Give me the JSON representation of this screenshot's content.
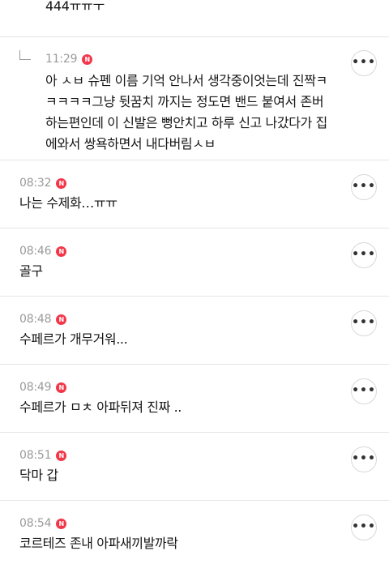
{
  "top_partial": {
    "text": "444ㅠㅠㅜ"
  },
  "reply": {
    "time": "11:29",
    "badge": "N",
    "text": "아 ㅅㅂ 슈펜 이름 기억 안나서 생각중이엇는데 진짝ㅋ\nㅋㅋㅋㅋ그냥 뒷꿈치 까지는 정도면 밴드 붙여서 존버\n하는편인데 이 신발은 뻥안치고 하루 신고 나갔다가 집\n에와서 쌍욕하면서 내다버림ㅅㅂ"
  },
  "comments": [
    {
      "time": "08:32",
      "badge": "N",
      "text": "나는 수제화…ㅠㅠ"
    },
    {
      "time": "08:46",
      "badge": "N",
      "text": "골구"
    },
    {
      "time": "08:48",
      "badge": "N",
      "text": "수페르가 개무거워..."
    },
    {
      "time": "08:49",
      "badge": "N",
      "text": "수페르가 ㅁㅊ 아파뒤져 진짜 .."
    },
    {
      "time": "08:51",
      "badge": "N",
      "text": "닥마 갑"
    },
    {
      "time": "08:54",
      "badge": "N",
      "text": "코르테즈 존내 아파새끼발까락"
    }
  ],
  "more_button": {
    "glyph": "•••"
  },
  "colors": {
    "badge": "#f2374a",
    "time": "#9a9a9a",
    "divider": "#e4e4e4"
  }
}
